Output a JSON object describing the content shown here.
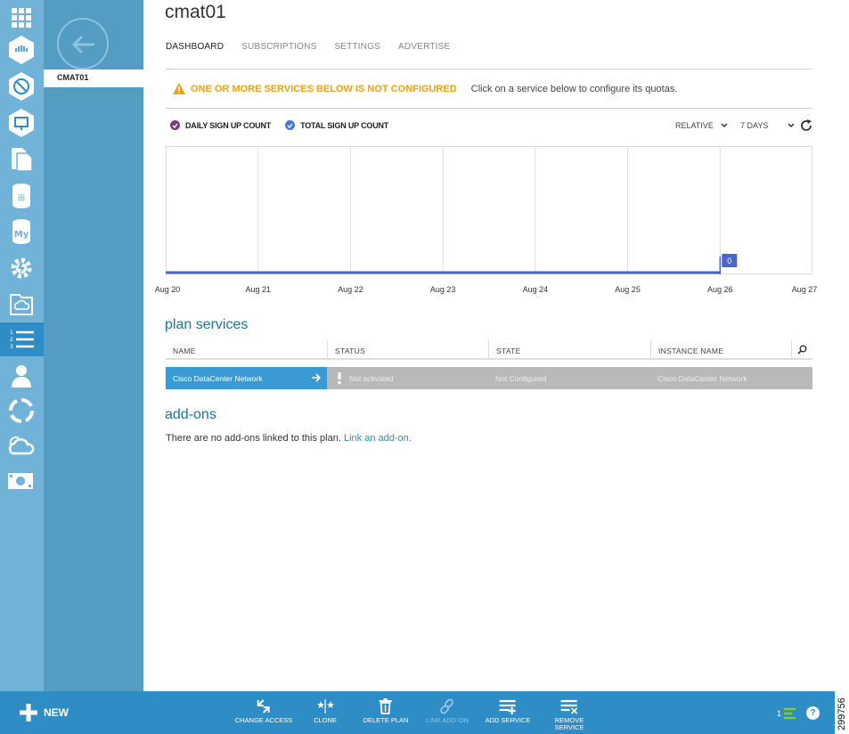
{
  "page": {
    "title": "cmat01"
  },
  "nav": {
    "back_label": "",
    "item": "CMAT01"
  },
  "tabs": [
    {
      "label": "DASHBOARD",
      "active": true
    },
    {
      "label": "SUBSCRIPTIONS",
      "active": false
    },
    {
      "label": "SETTINGS",
      "active": false
    },
    {
      "label": "ADVERTISE",
      "active": false
    }
  ],
  "warning": {
    "title": "ONE OR MORE SERVICES BELOW IS NOT CONFIGURED",
    "hint": "Click on a service below to configure its quotas."
  },
  "legend": {
    "daily": "DAILY SIGN UP COUNT",
    "total": "TOTAL SIGN UP COUNT",
    "daily_color": "#7b3a7a",
    "total_color": "#4a79c9"
  },
  "chart_controls": {
    "mode": "RELATIVE",
    "range": "7 DAYS"
  },
  "chart_data": {
    "type": "line",
    "x": [
      "Aug 20",
      "Aug 21",
      "Aug 22",
      "Aug 23",
      "Aug 24",
      "Aug 25",
      "Aug 26",
      "Aug 27"
    ],
    "series": [
      {
        "name": "TOTAL SIGN UP COUNT",
        "values": [
          0,
          0,
          0,
          0,
          0,
          0,
          0
        ]
      }
    ],
    "annotations": [
      {
        "x": "Aug 26",
        "label": "0"
      }
    ],
    "grid": true,
    "color": "#4a64c8"
  },
  "plan_services": {
    "title": "plan services",
    "columns": [
      "NAME",
      "STATUS",
      "STATE",
      "INSTANCE NAME"
    ],
    "rows": [
      {
        "name": "Cisco DataCenter Network",
        "status": "Not activated",
        "state": "Not Configured",
        "instance": "Cisco DataCenter Network"
      }
    ]
  },
  "addons": {
    "title": "add-ons",
    "text": "There are no add-ons linked to this plan.",
    "link": "Link an add-on."
  },
  "commands": {
    "new": "NEW",
    "change_access": "CHANGE ACCESS",
    "clone": "CLONE",
    "delete_plan": "DELETE PLAN",
    "link_addon": "LINK ADD-ON",
    "add_service": "ADD SERVICE",
    "remove_service_1": "REMOVE",
    "remove_service_2": "SERVICE",
    "help": "?",
    "counter": "1"
  },
  "figure_id": "299756",
  "colors": {
    "rail": "#70b2d8",
    "nav": "#539cc2",
    "bar": "#2f8dc6",
    "accent": "#1a73a8",
    "warning": "#f0a30a"
  }
}
